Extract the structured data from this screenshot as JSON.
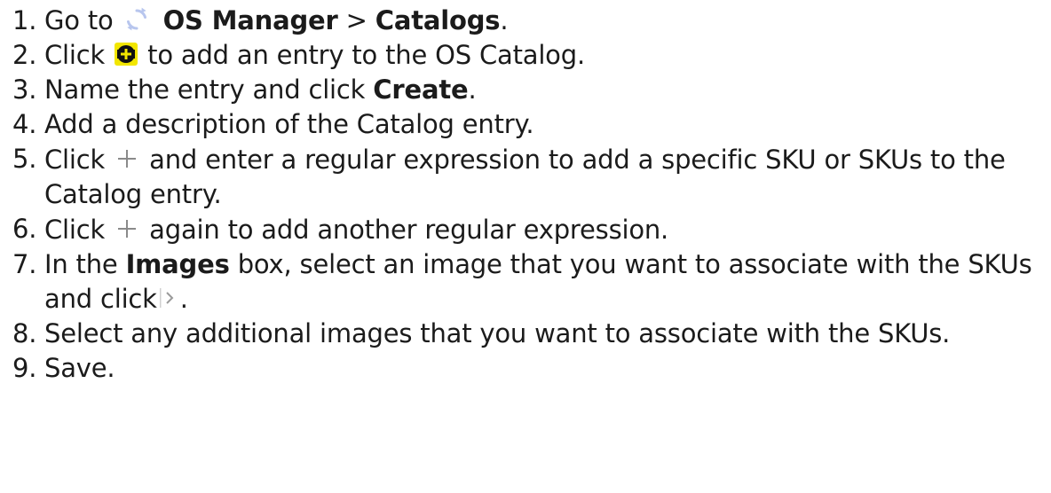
{
  "steps": [
    {
      "num": "1.",
      "t1": "Go to",
      "b1": "OS Manager",
      "t2": ">",
      "b2": "Catalogs",
      "t3": "."
    },
    {
      "num": "2.",
      "t1": "Click",
      "t2": "to add an entry to the OS Catalog."
    },
    {
      "num": "3.",
      "t1": "Name the entry and click",
      "b1": "Create",
      "t2": "."
    },
    {
      "num": "4.",
      "t1": "Add a description of the Catalog entry."
    },
    {
      "num": "5.",
      "t1": "Click",
      "t2": "and enter a regular expression to add a specific SKU or SKUs to the Catalog entry."
    },
    {
      "num": "6.",
      "t1": "Click",
      "t2": "again to add another regular expression."
    },
    {
      "num": "7.",
      "t1": "In the",
      "b1": "Images",
      "t2": "box, select an image that you want to associate with the SKUs and click",
      "t3": "."
    },
    {
      "num": "8.",
      "t1": "Select any additional images that you want to associate with the SKUs."
    },
    {
      "num": "9.",
      "t1": "Save."
    }
  ],
  "icons": {
    "sync": "sync-icon",
    "add_entry": "add-entry-icon",
    "plus": "plus-icon",
    "chevron": "chevron-right-icon"
  },
  "colors": {
    "text": "#1b1b1b",
    "sync_icon": "#b8c6ee",
    "add_icon_bg": "#f2e600",
    "add_icon_fg": "#111111",
    "plus_icon": "#8a8a8a",
    "chevron_icon": "#9a9a9a"
  }
}
